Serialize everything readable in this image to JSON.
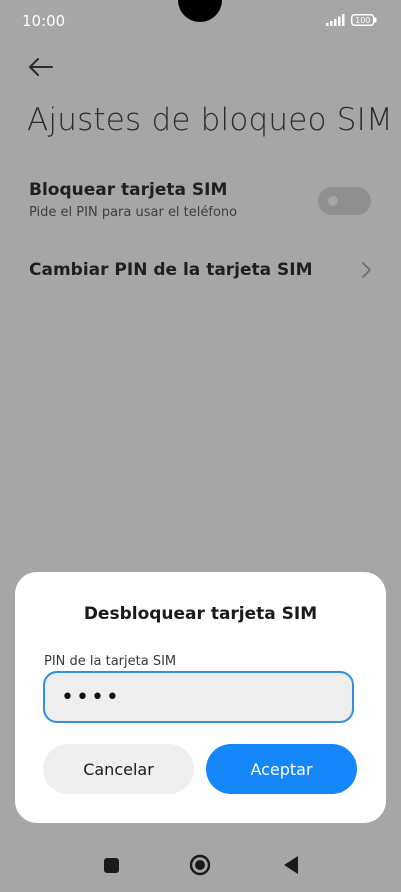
{
  "status_bar": {
    "time": "10:00",
    "battery": "100"
  },
  "page": {
    "title": "Ajustes de bloqueo SIM",
    "lock_sim": {
      "title": "Bloquear tarjeta SIM",
      "subtitle": "Pide el PIN para usar el teléfono",
      "enabled": false
    },
    "change_pin": {
      "title": "Cambiar PIN de la tarjeta SIM"
    }
  },
  "dialog": {
    "title": "Desbloquear tarjeta SIM",
    "field_label": "PIN de la tarjeta SIM",
    "pin_value": "••••",
    "cancel_label": "Cancelar",
    "ok_label": "Aceptar"
  },
  "colors": {
    "accent": "#1587fa",
    "input_border": "#2f8fe0",
    "dim_background": "#a6a6a6"
  }
}
